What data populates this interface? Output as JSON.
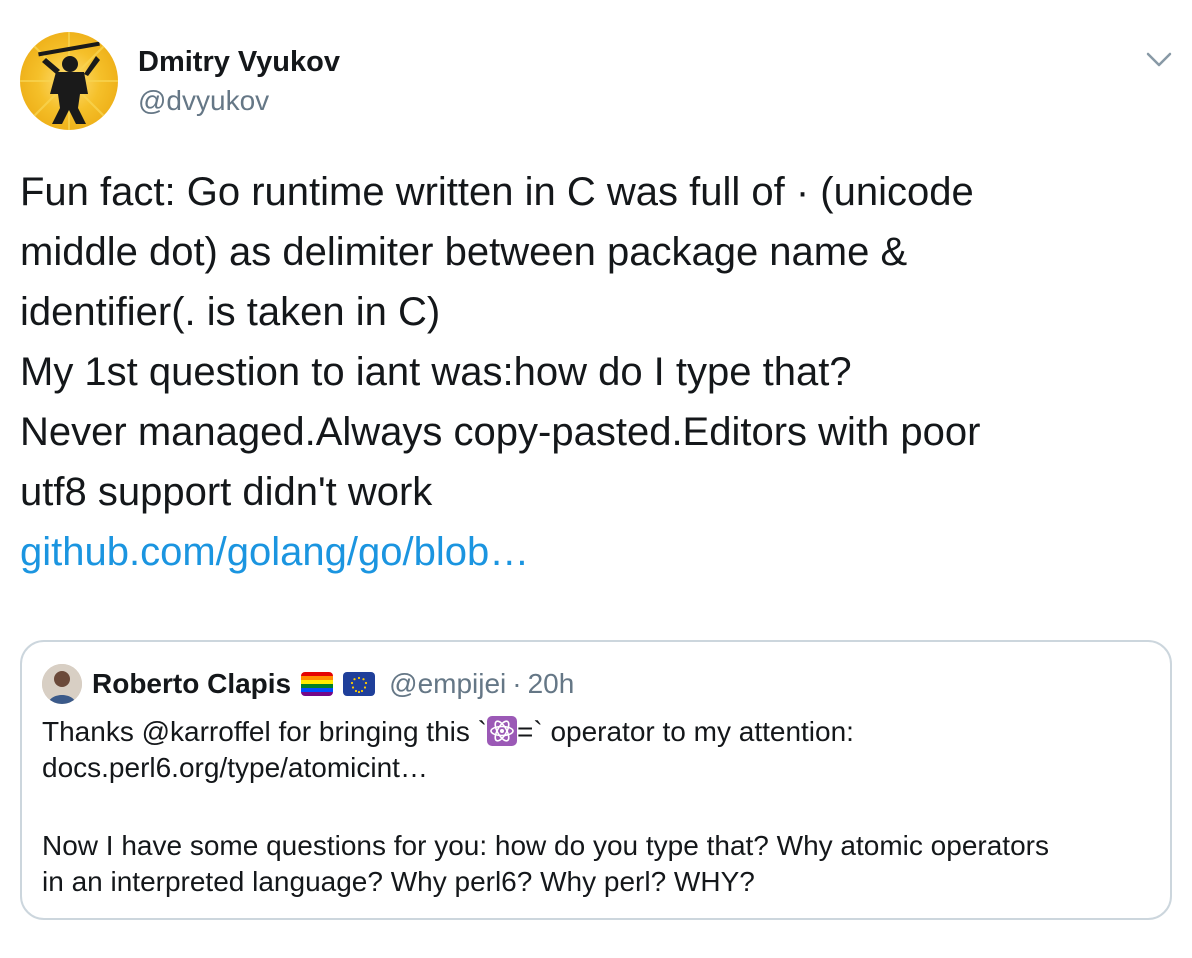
{
  "author": {
    "name": "Dmitry Vyukov",
    "handle": "@dvyukov",
    "avatar_icon": "ninja-silhouette-avatar"
  },
  "menu_icon": "chevron-down-icon",
  "tweet": {
    "lines": [
      "Fun fact: Go runtime written in C was full of · (unicode",
      "middle dot) as delimiter between package name &",
      "identifier(. is taken in C)",
      "My 1st question to iant was:how do I type that?",
      "Never managed.Always copy-pasted.Editors with poor",
      "utf8 support didn't work"
    ],
    "link": "github.com/golang/go/blob…"
  },
  "quoted": {
    "name": "Roberto Clapis",
    "flags": [
      "rainbow-flag-icon",
      "eu-flag-icon"
    ],
    "handle": "@empijei",
    "separator": "·",
    "time": "20h",
    "line1_before": "Thanks @karroffel for bringing this `",
    "line1_after": "=` operator to my attention:",
    "line2": "docs.perl6.org/type/atomicint…",
    "line3": "Now I have some questions for you: how do you type that? Why atomic operators",
    "line4": "in an interpreted language? Why perl6? Why perl? WHY?"
  },
  "colors": {
    "text": "#14171a",
    "secondary": "#657786",
    "link": "#1b95e0",
    "border": "#ccd6dd"
  }
}
